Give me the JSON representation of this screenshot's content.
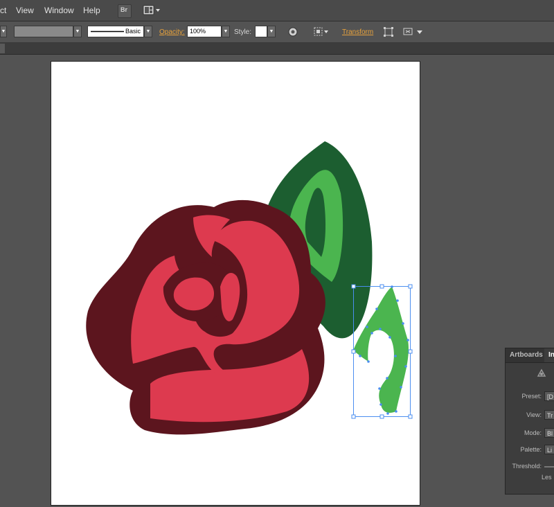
{
  "menubar": {
    "items": [
      "ct",
      "View",
      "Window",
      "Help"
    ],
    "bridge_label": "Br"
  },
  "controlbar": {
    "stroke_profile": "Basic",
    "opacity_label": "Opacity:",
    "opacity_value": "100%",
    "style_label": "Style:",
    "transform_label": "Transform"
  },
  "panel": {
    "tabs": [
      "Artboards",
      "In"
    ],
    "rows": [
      {
        "label": "Preset:",
        "value": "[D"
      },
      {
        "label": "View:",
        "value": "Tr"
      },
      {
        "label": "Mode:",
        "value": "Bl"
      },
      {
        "label": "Palette:",
        "value": "Li"
      },
      {
        "label": "Threshold:",
        "value": ""
      }
    ],
    "less_label": "Les"
  },
  "colors": {
    "rose_outline": "#5c151e",
    "rose_fill": "#dd3a4f",
    "leaf_dark": "#1c5e30",
    "leaf_light": "#4bb54f",
    "selection": "#4a8ef0",
    "accent_link": "#e8a33d"
  }
}
